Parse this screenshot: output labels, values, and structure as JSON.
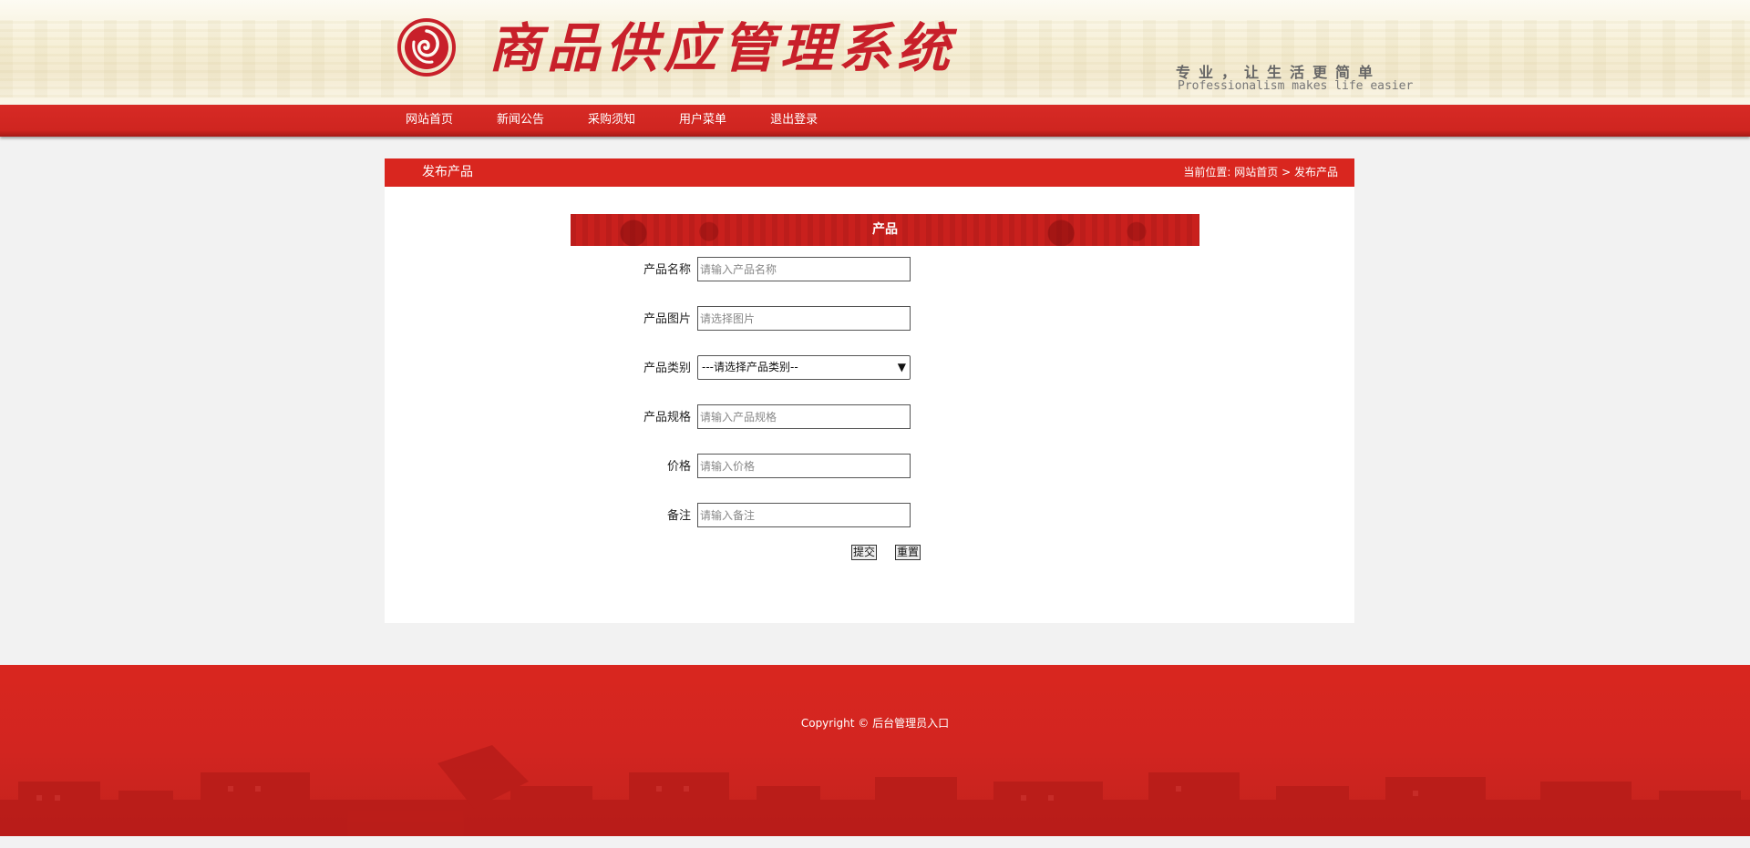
{
  "header": {
    "site_title": "商品供应管理系统",
    "slogan_cn": "专业，让生活更简单",
    "slogan_en": "Professionalism makes life easier"
  },
  "nav": {
    "items": [
      {
        "label": "网站首页"
      },
      {
        "label": "新闻公告"
      },
      {
        "label": "采购须知"
      },
      {
        "label": "用户菜单"
      },
      {
        "label": "退出登录"
      }
    ]
  },
  "panel": {
    "title": "发布产品",
    "breadcrumb": {
      "prefix": "当前位置:",
      "home": "网站首页",
      "separator": ">",
      "current": "发布产品"
    }
  },
  "form": {
    "title": "产品",
    "fields": [
      {
        "label": "产品名称",
        "placeholder": "请输入产品名称",
        "value": ""
      },
      {
        "label": "产品图片",
        "placeholder": "请选择图片",
        "value": ""
      },
      {
        "label": "产品类别",
        "selected": "---请选择产品类别--"
      },
      {
        "label": "产品规格",
        "placeholder": "请输入产品规格",
        "value": ""
      },
      {
        "label": "价格",
        "placeholder": "请输入价格",
        "value": ""
      },
      {
        "label": "备注",
        "placeholder": "请输入备注",
        "value": ""
      }
    ],
    "submit_label": "提交",
    "reset_label": "重置"
  },
  "footer": {
    "copyright": "Copyright ©",
    "admin_link": "后台管理员入口"
  },
  "colors": {
    "brand_red": "#d9261f",
    "page_bg": "#f2f2f2"
  }
}
